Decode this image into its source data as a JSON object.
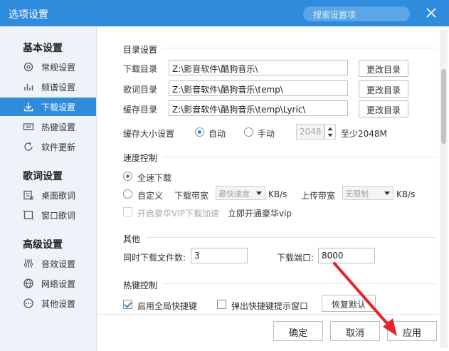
{
  "window": {
    "title": "选项设置",
    "search_placeholder": "搜索设置项"
  },
  "sidebar": {
    "sections": [
      {
        "title": "基本设置",
        "items": [
          {
            "label": "常规设置",
            "icon": "gear-icon"
          },
          {
            "label": "频谱设置",
            "icon": "spectrum-icon"
          },
          {
            "label": "下载设置",
            "icon": "download-icon",
            "active": true
          },
          {
            "label": "热键设置",
            "icon": "keyboard-icon"
          },
          {
            "label": "软件更新",
            "icon": "refresh-icon"
          }
        ]
      },
      {
        "title": "歌词设置",
        "items": [
          {
            "label": "桌面歌词",
            "icon": "desktop-lyric-icon"
          },
          {
            "label": "窗口歌词",
            "icon": "window-lyric-icon"
          }
        ]
      },
      {
        "title": "高级设置",
        "items": [
          {
            "label": "音效设置",
            "icon": "equalizer-icon"
          },
          {
            "label": "网络设置",
            "icon": "globe-icon"
          },
          {
            "label": "其他设置",
            "icon": "more-icon"
          }
        ]
      }
    ]
  },
  "directory": {
    "title": "目录设置",
    "rows": [
      {
        "label": "下载目录",
        "value": "Z:\\影音软件\\酷狗音乐\\",
        "button": "更改目录"
      },
      {
        "label": "歌词目录",
        "value": "Z:\\影音软件\\酷狗音乐\\temp\\",
        "button": "更改目录"
      },
      {
        "label": "缓存目录",
        "value": "Z:\\影音软件\\酷狗音乐\\temp\\Lyric\\",
        "button": "更改目录"
      }
    ],
    "cache_label": "缓存大小设置",
    "cache_auto": "自动",
    "cache_manual": "手动",
    "cache_value": "2048",
    "cache_hint": "至少2048M"
  },
  "speed": {
    "title": "速度控制",
    "full_speed": "全速下载",
    "custom": "自定义",
    "download_bw_label": "下载带宽",
    "download_bw_value": "最快速度",
    "download_unit": "KB/s",
    "upload_bw_label": "上传带宽",
    "upload_bw_value": "无限制",
    "upload_unit": "KB/s",
    "vip_checkbox": "开启豪华VIP下载加速",
    "vip_link": "立即开通豪华vip"
  },
  "other": {
    "title": "其他",
    "concurrent_label": "同时下载文件数:",
    "concurrent_value": "3",
    "port_label": "下载端口:",
    "port_value": "8000"
  },
  "hotkey": {
    "title": "热键控制",
    "global_hotkey": "启用全局快捷键",
    "popup_tip": "弹出快捷键提示窗口",
    "restore_default": "恢复默认"
  },
  "footer": {
    "ok": "确定",
    "cancel": "取消",
    "apply": "应用"
  },
  "colors": {
    "accent": "#2f8bdc",
    "annotation_arrow": "#e8222a"
  }
}
